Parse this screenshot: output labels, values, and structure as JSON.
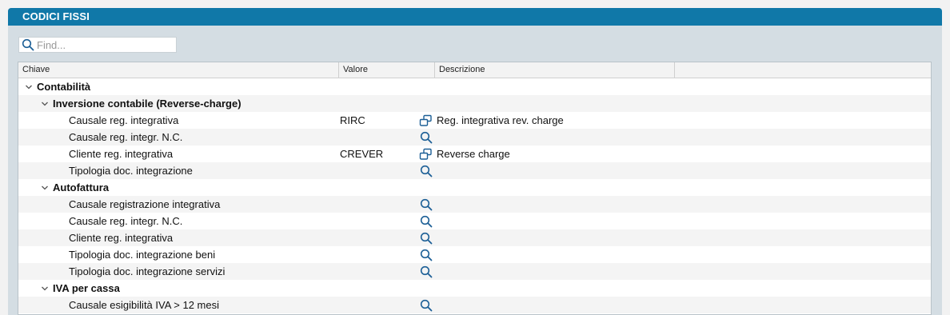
{
  "window": {
    "title": "CODICI FISSI"
  },
  "search": {
    "placeholder": "Find...",
    "icon": "search-icon"
  },
  "table": {
    "columns": [
      "Chiave",
      "Valore",
      "Descrizione"
    ],
    "rows": [
      {
        "level": 0,
        "expanded": true,
        "key": "Contabilità",
        "value": "",
        "icon": "",
        "description": ""
      },
      {
        "level": 1,
        "expanded": true,
        "key": "Inversione contabile (Reverse-charge)",
        "value": "",
        "icon": "",
        "description": ""
      },
      {
        "level": 2,
        "key": "Causale reg. integrativa",
        "value": "RIRC",
        "icon": "open-window-icon",
        "description": "Reg. integrativa rev. charge"
      },
      {
        "level": 2,
        "key": "Causale reg. integr. N.C.",
        "value": "",
        "icon": "search-icon",
        "description": ""
      },
      {
        "level": 2,
        "key": "Cliente reg. integrativa",
        "value": "CREVER",
        "icon": "open-window-icon",
        "description": "Reverse charge"
      },
      {
        "level": 2,
        "key": "Tipologia doc. integrazione",
        "value": "",
        "icon": "search-icon",
        "description": ""
      },
      {
        "level": 1,
        "expanded": true,
        "key": "Autofattura",
        "value": "",
        "icon": "",
        "description": ""
      },
      {
        "level": 2,
        "key": "Causale registrazione integrativa",
        "value": "",
        "icon": "search-icon",
        "description": ""
      },
      {
        "level": 2,
        "key": "Causale reg. integr. N.C.",
        "value": "",
        "icon": "search-icon",
        "description": ""
      },
      {
        "level": 2,
        "key": "Cliente reg. integrativa",
        "value": "",
        "icon": "search-icon",
        "description": ""
      },
      {
        "level": 2,
        "key": "Tipologia doc. integrazione beni",
        "value": "",
        "icon": "search-icon",
        "description": ""
      },
      {
        "level": 2,
        "key": "Tipologia doc. integrazione servizi",
        "value": "",
        "icon": "search-icon",
        "description": ""
      },
      {
        "level": 1,
        "expanded": true,
        "key": "IVA per cassa",
        "value": "",
        "icon": "",
        "description": ""
      },
      {
        "level": 2,
        "key": "Causale esigibilità IVA > 12 mesi",
        "value": "",
        "icon": "search-icon",
        "description": ""
      }
    ]
  },
  "colors": {
    "titlebar": "#1078a8",
    "panel": "#d4dde3",
    "icon": "#1c5f96"
  }
}
